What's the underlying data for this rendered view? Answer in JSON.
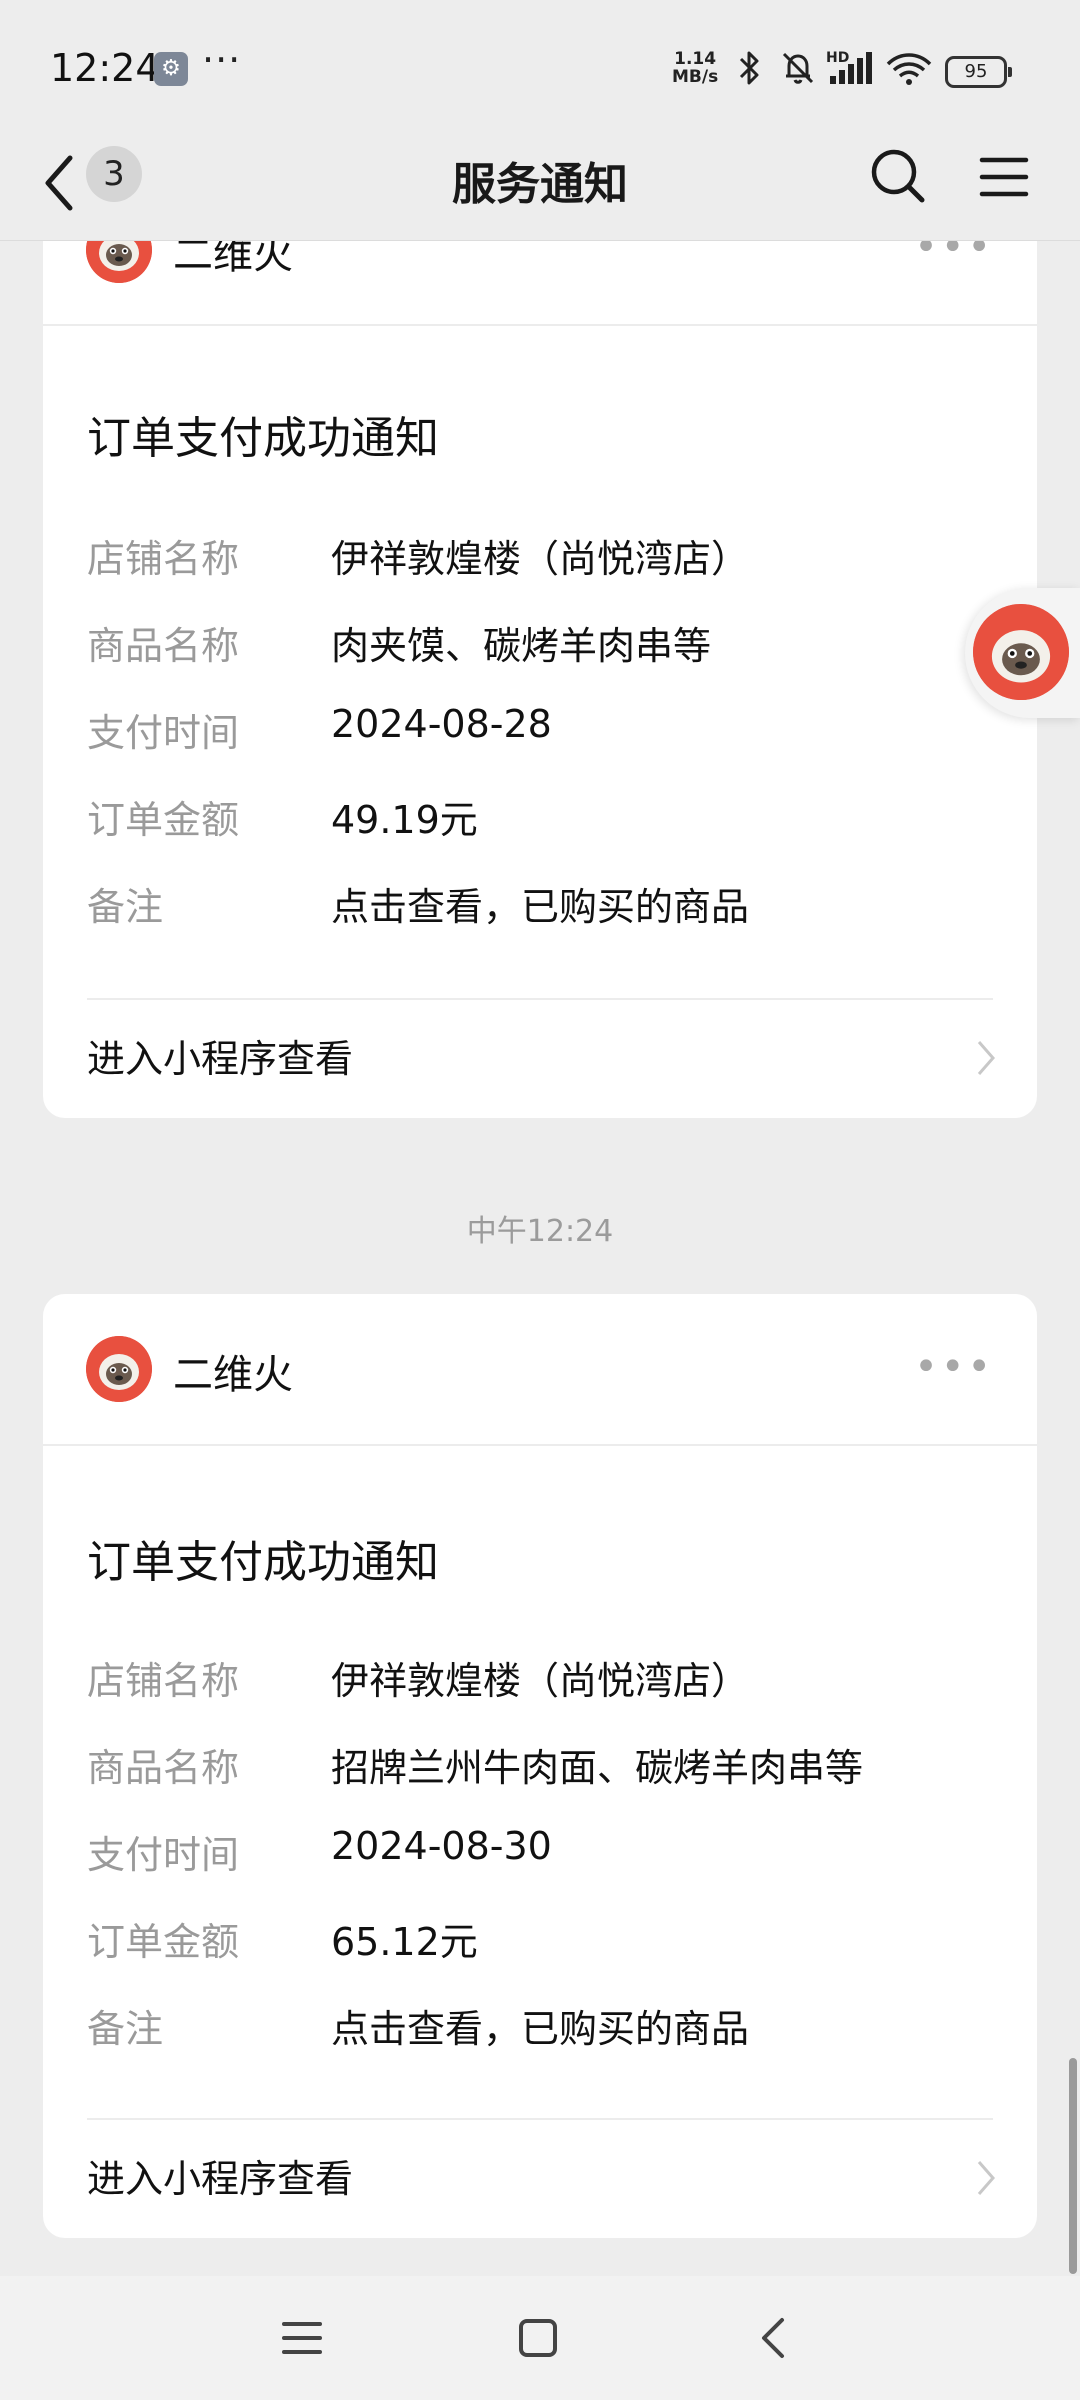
{
  "status_bar": {
    "time": "12:24",
    "net_speed_value": "1.14",
    "net_speed_unit": "MB/s",
    "hd_label": "HD",
    "battery": "95",
    "icons": [
      "wrench-icon",
      "more-dots-icon",
      "bluetooth-icon",
      "mute-bell-icon",
      "signal-icon",
      "wifi-icon",
      "battery-icon"
    ]
  },
  "nav": {
    "title": "服务通知",
    "unread_count": "3",
    "icons": [
      "back-arrow-icon",
      "search-icon",
      "menu-icon"
    ]
  },
  "cards": [
    {
      "sender": "二维火",
      "title": "订单支付成功通知",
      "fields": [
        {
          "key": "店铺名称",
          "value": "伊祥敦煌楼（尚悦湾店）"
        },
        {
          "key": "商品名称",
          "value": "肉夹馍、碳烤羊肉串等"
        },
        {
          "key": "支付时间",
          "value": "2024-08-28"
        },
        {
          "key": "订单金额",
          "value": "49.19元"
        },
        {
          "key": "备注",
          "value": "点击查看，已购买的商品"
        }
      ],
      "link": "进入小程序查看"
    },
    {
      "sender": "二维火",
      "title": "订单支付成功通知",
      "fields": [
        {
          "key": "店铺名称",
          "value": "伊祥敦煌楼（尚悦湾店）"
        },
        {
          "key": "商品名称",
          "value": "招牌兰州牛肉面、碳烤羊肉串等"
        },
        {
          "key": "支付时间",
          "value": "2024-08-30"
        },
        {
          "key": "订单金额",
          "value": "65.12元"
        },
        {
          "key": "备注",
          "value": "点击查看，已购买的商品"
        }
      ],
      "link": "进入小程序查看"
    }
  ],
  "timestamp": "中午12:24",
  "colors": {
    "background": "#ededed",
    "card": "#ffffff",
    "label_gray": "#9a9a9a",
    "avatar_red": "#e8503f"
  }
}
